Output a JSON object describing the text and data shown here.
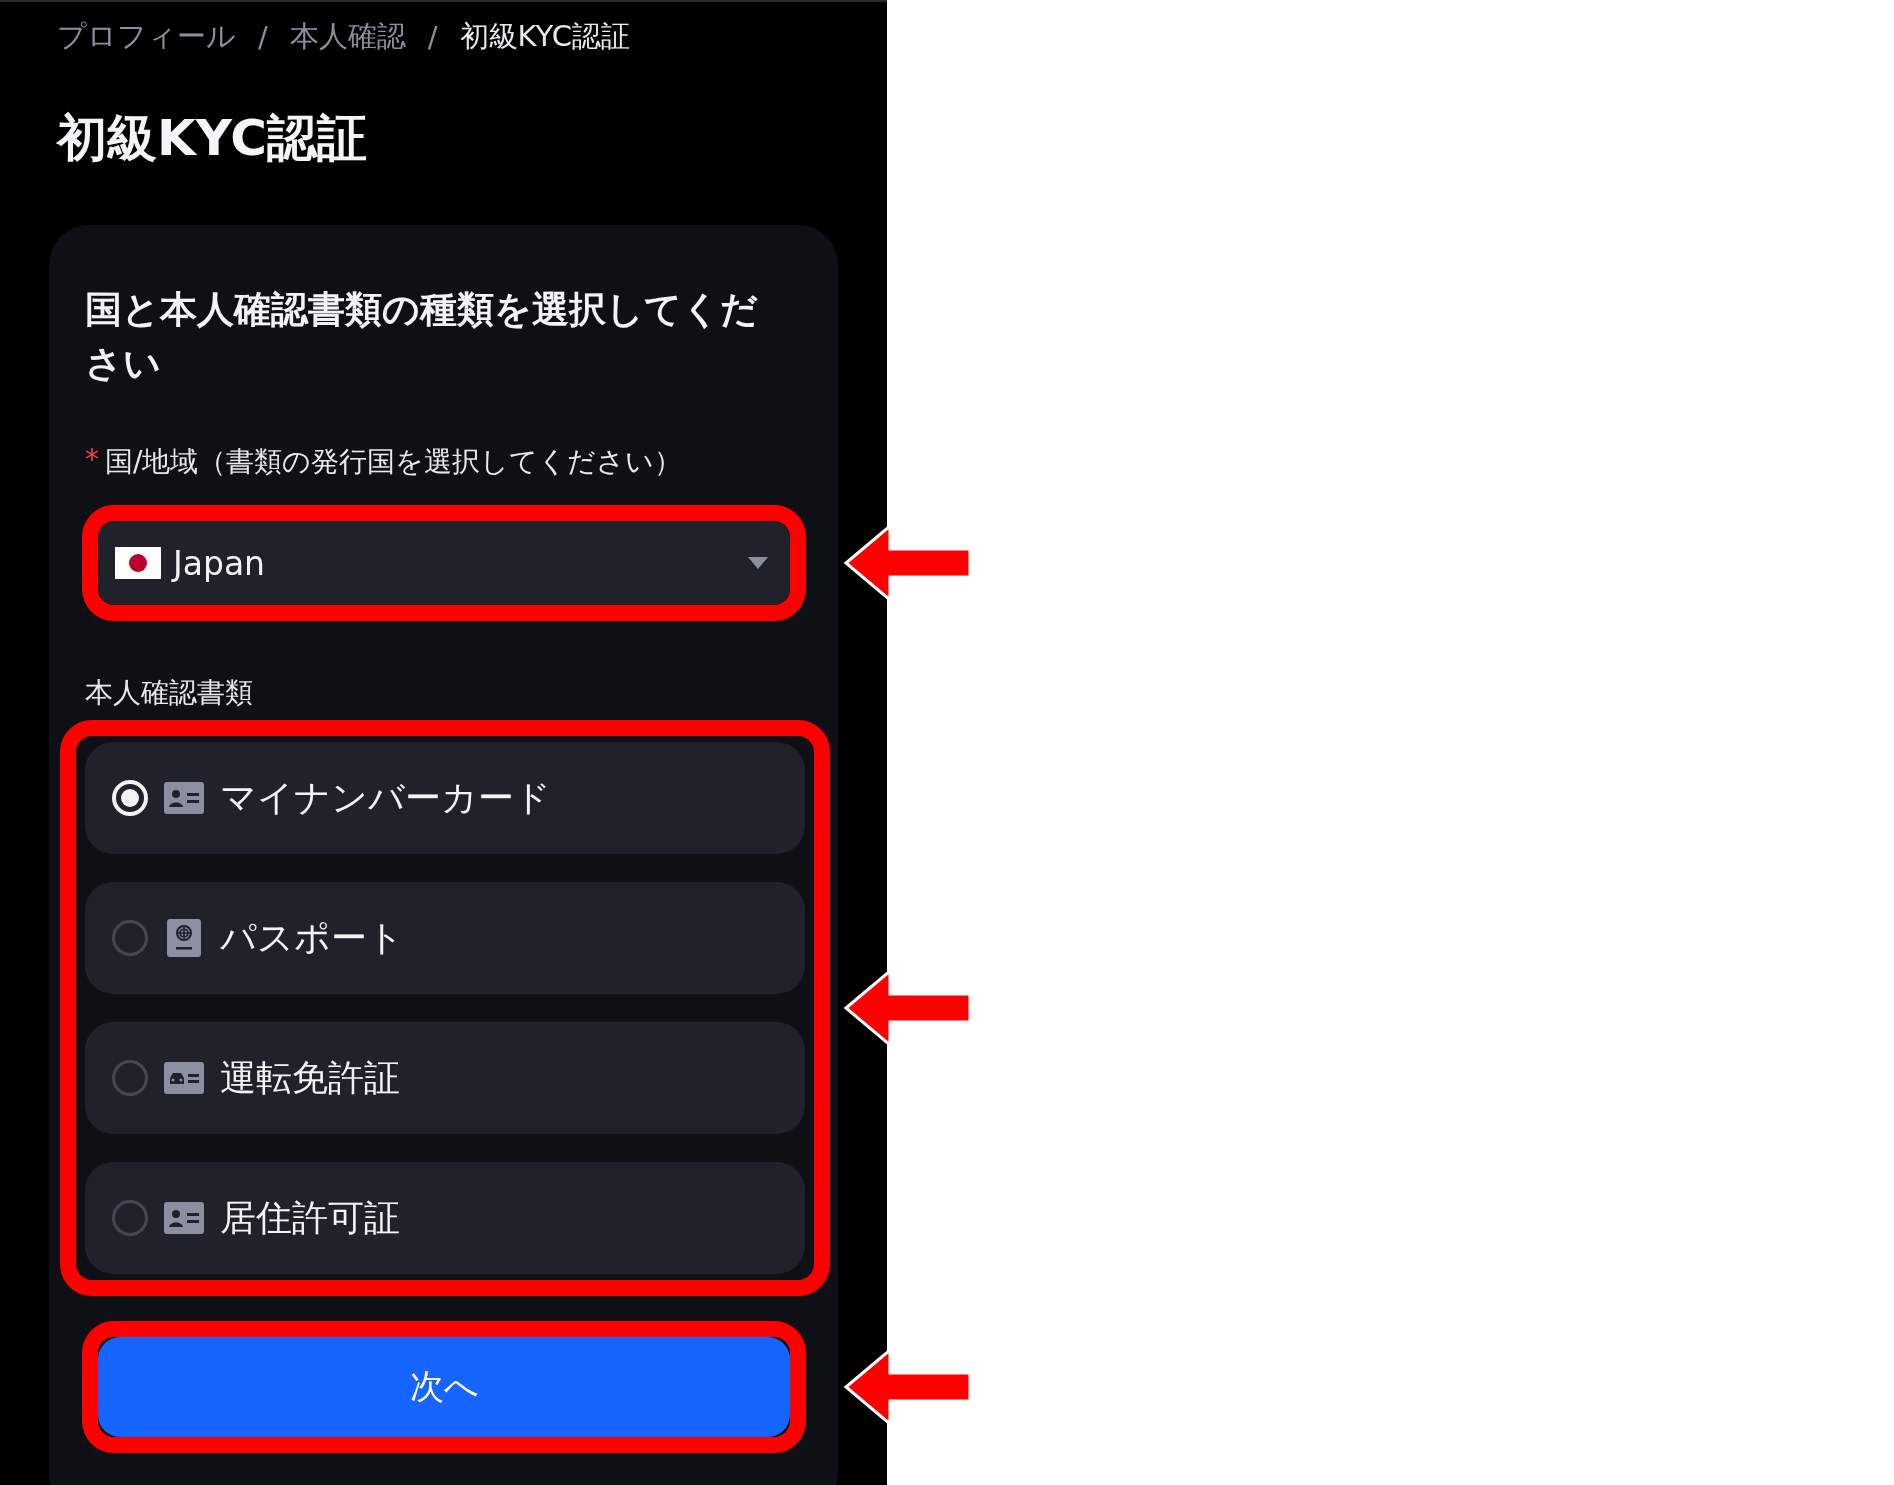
{
  "breadcrumb": [
    {
      "label": "プロフィール",
      "current": false
    },
    {
      "separator": "/",
      "label": "本人確認",
      "current": false
    },
    {
      "separator": "/",
      "label": "初級KYC認証",
      "current": true
    }
  ],
  "title": "初級KYC認証",
  "card": {
    "heading": "国と本人確認書類の種類を選択してください",
    "country": {
      "label": "国/地域（書類の発行国を選択してください）",
      "required_mark": "*",
      "value": "Japan",
      "highlighted": true
    },
    "documents": {
      "label": "本人確認書類",
      "highlighted": true,
      "options": [
        {
          "label": "マイナンバーカード",
          "kind": "id-card",
          "selected": true
        },
        {
          "label": "パスポート",
          "kind": "passport",
          "selected": false
        },
        {
          "label": "運転免許証",
          "kind": "car-card",
          "selected": false
        },
        {
          "label": "居住許可証",
          "kind": "id-card",
          "selected": false
        }
      ]
    },
    "next_button": {
      "label": "次へ",
      "highlighted": true
    }
  }
}
